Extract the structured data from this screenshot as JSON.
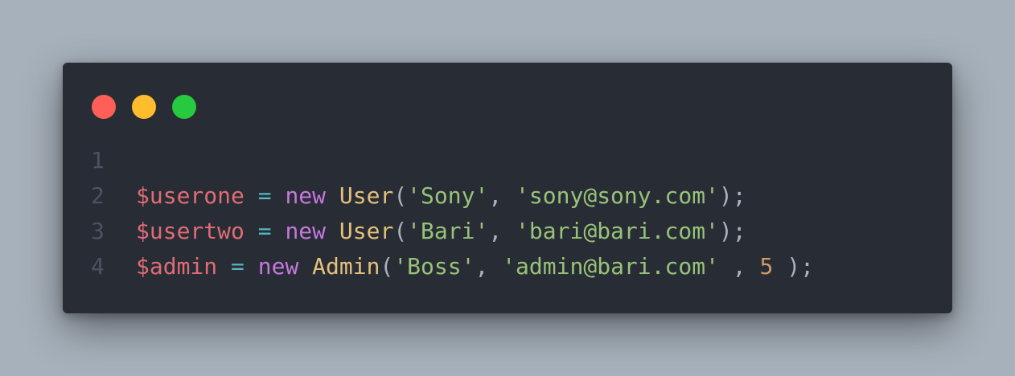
{
  "colors": {
    "background": "#a7b1bb",
    "window": "#282c35",
    "close": "#ff5f56",
    "minimize": "#ffbd2e",
    "maximize": "#27c93f",
    "line_number": "#4b5263",
    "variable": "#e06c75",
    "operator": "#56b6c2",
    "keyword": "#c678dd",
    "class": "#e5c07b",
    "string": "#98c379",
    "number": "#d19a66",
    "punctuation": "#abb2bf"
  },
  "code": {
    "lines": [
      {
        "number": "1"
      },
      {
        "number": "2",
        "var": "$userone",
        "op": " = ",
        "kw": "new",
        "sp": " ",
        "cls": "User",
        "open": "(",
        "str1": "'Sony'",
        "comma": ", ",
        "str2": "'sony@sony.com'",
        "close": ");"
      },
      {
        "number": "3",
        "var": "$usertwo",
        "op": " = ",
        "kw": "new",
        "sp": " ",
        "cls": "User",
        "open": "(",
        "str1": "'Bari'",
        "comma": ", ",
        "str2": "'bari@bari.com'",
        "close": ");"
      },
      {
        "number": "4",
        "var": "$admin",
        "op": " = ",
        "kw": "new",
        "sp": " ",
        "cls": "Admin",
        "open": "(",
        "str1": "'Boss'",
        "comma": ", ",
        "str2": "'admin@bari.com'",
        "comma2": " , ",
        "num": "5",
        "close": " );"
      }
    ]
  }
}
